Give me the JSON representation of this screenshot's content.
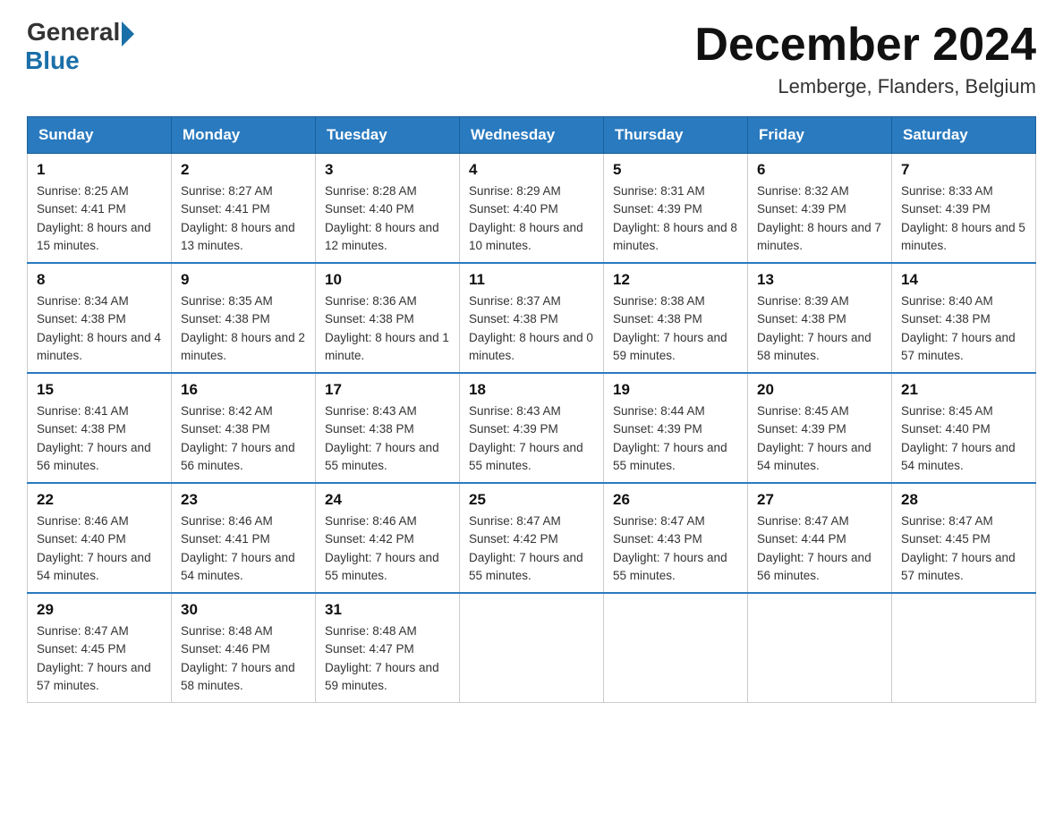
{
  "logo": {
    "general": "General",
    "blue": "Blue"
  },
  "header": {
    "title": "December 2024",
    "location": "Lemberge, Flanders, Belgium"
  },
  "days_of_week": [
    "Sunday",
    "Monday",
    "Tuesday",
    "Wednesday",
    "Thursday",
    "Friday",
    "Saturday"
  ],
  "weeks": [
    [
      {
        "day": "1",
        "sunrise": "8:25 AM",
        "sunset": "4:41 PM",
        "daylight": "8 hours and 15 minutes."
      },
      {
        "day": "2",
        "sunrise": "8:27 AM",
        "sunset": "4:41 PM",
        "daylight": "8 hours and 13 minutes."
      },
      {
        "day": "3",
        "sunrise": "8:28 AM",
        "sunset": "4:40 PM",
        "daylight": "8 hours and 12 minutes."
      },
      {
        "day": "4",
        "sunrise": "8:29 AM",
        "sunset": "4:40 PM",
        "daylight": "8 hours and 10 minutes."
      },
      {
        "day": "5",
        "sunrise": "8:31 AM",
        "sunset": "4:39 PM",
        "daylight": "8 hours and 8 minutes."
      },
      {
        "day": "6",
        "sunrise": "8:32 AM",
        "sunset": "4:39 PM",
        "daylight": "8 hours and 7 minutes."
      },
      {
        "day": "7",
        "sunrise": "8:33 AM",
        "sunset": "4:39 PM",
        "daylight": "8 hours and 5 minutes."
      }
    ],
    [
      {
        "day": "8",
        "sunrise": "8:34 AM",
        "sunset": "4:38 PM",
        "daylight": "8 hours and 4 minutes."
      },
      {
        "day": "9",
        "sunrise": "8:35 AM",
        "sunset": "4:38 PM",
        "daylight": "8 hours and 2 minutes."
      },
      {
        "day": "10",
        "sunrise": "8:36 AM",
        "sunset": "4:38 PM",
        "daylight": "8 hours and 1 minute."
      },
      {
        "day": "11",
        "sunrise": "8:37 AM",
        "sunset": "4:38 PM",
        "daylight": "8 hours and 0 minutes."
      },
      {
        "day": "12",
        "sunrise": "8:38 AM",
        "sunset": "4:38 PM",
        "daylight": "7 hours and 59 minutes."
      },
      {
        "day": "13",
        "sunrise": "8:39 AM",
        "sunset": "4:38 PM",
        "daylight": "7 hours and 58 minutes."
      },
      {
        "day": "14",
        "sunrise": "8:40 AM",
        "sunset": "4:38 PM",
        "daylight": "7 hours and 57 minutes."
      }
    ],
    [
      {
        "day": "15",
        "sunrise": "8:41 AM",
        "sunset": "4:38 PM",
        "daylight": "7 hours and 56 minutes."
      },
      {
        "day": "16",
        "sunrise": "8:42 AM",
        "sunset": "4:38 PM",
        "daylight": "7 hours and 56 minutes."
      },
      {
        "day": "17",
        "sunrise": "8:43 AM",
        "sunset": "4:38 PM",
        "daylight": "7 hours and 55 minutes."
      },
      {
        "day": "18",
        "sunrise": "8:43 AM",
        "sunset": "4:39 PM",
        "daylight": "7 hours and 55 minutes."
      },
      {
        "day": "19",
        "sunrise": "8:44 AM",
        "sunset": "4:39 PM",
        "daylight": "7 hours and 55 minutes."
      },
      {
        "day": "20",
        "sunrise": "8:45 AM",
        "sunset": "4:39 PM",
        "daylight": "7 hours and 54 minutes."
      },
      {
        "day": "21",
        "sunrise": "8:45 AM",
        "sunset": "4:40 PM",
        "daylight": "7 hours and 54 minutes."
      }
    ],
    [
      {
        "day": "22",
        "sunrise": "8:46 AM",
        "sunset": "4:40 PM",
        "daylight": "7 hours and 54 minutes."
      },
      {
        "day": "23",
        "sunrise": "8:46 AM",
        "sunset": "4:41 PM",
        "daylight": "7 hours and 54 minutes."
      },
      {
        "day": "24",
        "sunrise": "8:46 AM",
        "sunset": "4:42 PM",
        "daylight": "7 hours and 55 minutes."
      },
      {
        "day": "25",
        "sunrise": "8:47 AM",
        "sunset": "4:42 PM",
        "daylight": "7 hours and 55 minutes."
      },
      {
        "day": "26",
        "sunrise": "8:47 AM",
        "sunset": "4:43 PM",
        "daylight": "7 hours and 55 minutes."
      },
      {
        "day": "27",
        "sunrise": "8:47 AM",
        "sunset": "4:44 PM",
        "daylight": "7 hours and 56 minutes."
      },
      {
        "day": "28",
        "sunrise": "8:47 AM",
        "sunset": "4:45 PM",
        "daylight": "7 hours and 57 minutes."
      }
    ],
    [
      {
        "day": "29",
        "sunrise": "8:47 AM",
        "sunset": "4:45 PM",
        "daylight": "7 hours and 57 minutes."
      },
      {
        "day": "30",
        "sunrise": "8:48 AM",
        "sunset": "4:46 PM",
        "daylight": "7 hours and 58 minutes."
      },
      {
        "day": "31",
        "sunrise": "8:48 AM",
        "sunset": "4:47 PM",
        "daylight": "7 hours and 59 minutes."
      },
      null,
      null,
      null,
      null
    ]
  ]
}
